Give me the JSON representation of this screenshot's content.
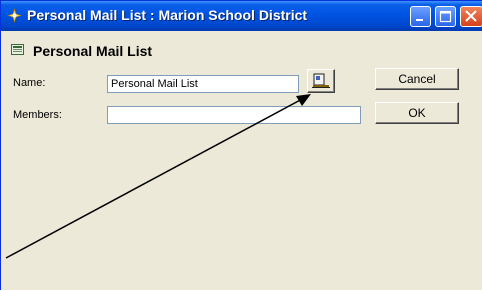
{
  "window": {
    "title": "Personal Mail List : Marion School District"
  },
  "header": {
    "title": "Personal Mail List"
  },
  "form": {
    "name_label": "Name:",
    "name_value": "Personal Mail List",
    "members_label": "Members:",
    "members_value": ""
  },
  "buttons": {
    "cancel": "Cancel",
    "ok": "OK"
  },
  "colors": {
    "titlebar": "#0054e3",
    "dialog_bg": "#ece9d8",
    "field_border": "#7f9db9"
  }
}
